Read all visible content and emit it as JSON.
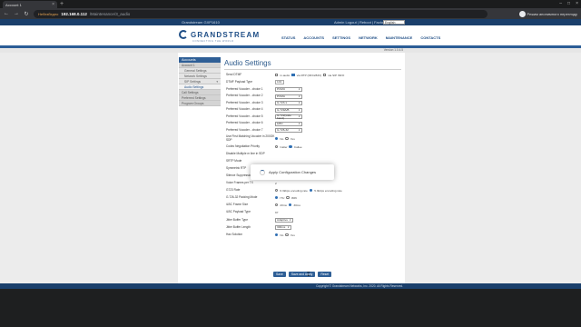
{
  "browser": {
    "tab_title": "Account 1",
    "secure_label": "Небезбедно",
    "host": "192.168.0.112",
    "path": "/Maintenance/3_audio",
    "translate_label": "Режим анонимного перегляду"
  },
  "device_bar": {
    "model": "Grandstream GXP1610",
    "links": "Admin Logout | Reboot | Factory Reset",
    "language": "English"
  },
  "header": {
    "logo": "GRANDSTREAM",
    "tagline": "CONNECTING THE WORLD",
    "nav": [
      "STATUS",
      "ACCOUNTS",
      "SETTINGS",
      "NETWORK",
      "MAINTENANCE",
      "CONTACTS"
    ]
  },
  "version": "Version 1.0.4.5",
  "sidebar": {
    "head": "Accounts",
    "items": [
      {
        "label": "Account 1",
        "level": 1
      },
      {
        "label": "General Settings",
        "level": 2
      },
      {
        "label": "Network Settings",
        "level": 2
      },
      {
        "label": "SIP Settings",
        "level": 2
      },
      {
        "label": "Audio Settings",
        "level": 2
      },
      {
        "label": "Call Settings",
        "level": 1
      },
      {
        "label": "Preferred Settings",
        "level": 1
      },
      {
        "label": "Program Groups",
        "level": 1
      }
    ]
  },
  "page_title": "Audio Settings",
  "form": {
    "send_dtmf": {
      "label": "Send DTMF",
      "opt1": "in-audio",
      "opt2": "via RTP (RFC2833)",
      "opt3": "via SIP INFO"
    },
    "dtmf_payload": {
      "label": "DTMF Payload Type",
      "value": "101"
    },
    "vocoders": [
      {
        "label": "Preferred Vocoder - choice 1",
        "value": "PCMU"
      },
      {
        "label": "Preferred Vocoder - choice 2",
        "value": "PCMA"
      },
      {
        "label": "Preferred Vocoder - choice 3",
        "value": "G.723.1"
      },
      {
        "label": "Preferred Vocoder - choice 4",
        "value": "G.729A/B"
      },
      {
        "label": "Preferred Vocoder - choice 5",
        "value": "G.722(wide band)"
      },
      {
        "label": "Preferred Vocoder - choice 6",
        "value": "iLBC"
      },
      {
        "label": "Preferred Vocoder - choice 7",
        "value": "G.726-32"
      }
    ],
    "first_matching": {
      "label": "Use First Matching Vocoder in 200OK SDP",
      "yes": "Yes",
      "no": "No"
    },
    "codec_priority": {
      "label": "Codec Negotiation Priority",
      "caller": "Caller",
      "callee": "Callee"
    },
    "disable_multiple": {
      "label": "Disable Multiple m line in SDP"
    },
    "srtp_mode": {
      "label": "SRTP Mode"
    },
    "symmetric_rtp": {
      "label": "Symmetric RTP",
      "no": "No",
      "yes": "Yes"
    },
    "silence": {
      "label": "Silence Suppression",
      "no": "No",
      "yes": "Yes"
    },
    "voice_frames": {
      "label": "Voice Frames per TX",
      "value": "2"
    },
    "g723_rate": {
      "label": "G723 Rate",
      "opt1": "6.3kbps encoding rate",
      "opt2": "5.3kbps encoding rate"
    },
    "g726_mode": {
      "label": "G.726-32 Packing Mode",
      "opt1": "ITU",
      "opt2": "I366"
    },
    "ilbc_frame": {
      "label": "iLBC Frame Size",
      "opt1": "20ms",
      "opt2": "30ms"
    },
    "ilbc_payload": {
      "label": "iLBC Payload Type",
      "value": "97"
    },
    "jitter_type": {
      "label": "Jitter Buffer Type",
      "value": "Adaptive"
    },
    "jitter_len": {
      "label": "Jitter Buffer Length",
      "value": "300ms"
    },
    "hac": {
      "label": "Hac Solution",
      "no": "No",
      "yes": "Yes"
    }
  },
  "buttons": {
    "save": "Save",
    "save_apply": "Save and Apply",
    "reset": "Reset"
  },
  "modal": {
    "text": "Apply Configuration Changes"
  },
  "footer": {
    "copyright": "Copyright © Grandstream Networks, Inc. 2020. All Rights Reserved."
  }
}
